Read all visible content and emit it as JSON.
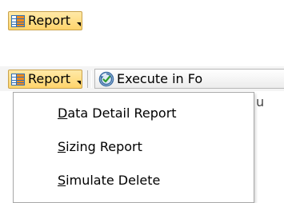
{
  "report_button_top": {
    "label": "Report",
    "icon": "grid-icon"
  },
  "toolbar": {
    "report_button": {
      "label": "Report",
      "icon": "grid-icon"
    },
    "execute_button": {
      "label": "Execute in Fo",
      "icon": "execute-icon"
    },
    "underlay_text": "u"
  },
  "report_menu": {
    "items": [
      {
        "mnemonic": "D",
        "rest": "ata Detail Report"
      },
      {
        "mnemonic": "S",
        "rest": "izing Report"
      },
      {
        "mnemonic": "S",
        "rest": "imulate Delete"
      }
    ]
  },
  "colors": {
    "button_gradient_top": "#ffe9a8",
    "button_gradient_bottom": "#ffd46b",
    "icon_blue": "#2f6fb5",
    "icon_orange": "#f08a1c"
  }
}
